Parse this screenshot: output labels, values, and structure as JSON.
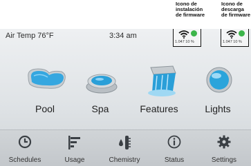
{
  "callouts": [
    {
      "lines": [
        "Icono de",
        "instalación",
        "de firmware"
      ]
    },
    {
      "lines": [
        "Icono de",
        "descarga",
        "de firmware"
      ]
    }
  ],
  "status_bar": {
    "air_temp": "Air Temp 76°F",
    "time": "3:34 am",
    "indicators": [
      {
        "text": "1.047  10 %",
        "dot_color": "#3cb54a"
      },
      {
        "text": "1.047  10 %",
        "dot_color": "#3cb54a"
      }
    ]
  },
  "main_tiles": [
    {
      "label": "Pool",
      "icon": "pool-icon"
    },
    {
      "label": "Spa",
      "icon": "spa-icon"
    },
    {
      "label": "Features",
      "icon": "waterfall-icon"
    },
    {
      "label": "Lights",
      "icon": "light-bulb-icon"
    }
  ],
  "bottom_nav": [
    {
      "label": "Schedules",
      "icon": "clock-icon"
    },
    {
      "label": "Usage",
      "icon": "bar-chart-icon"
    },
    {
      "label": "Chemistry",
      "icon": "thermometer-drop-icon"
    },
    {
      "label": "Status",
      "icon": "info-icon"
    },
    {
      "label": "Settings",
      "icon": "gear-icon"
    }
  ],
  "colors": {
    "accent_blue": "#2a9fd8",
    "status_green": "#3cb54a",
    "icon_dark": "#3a3f44"
  }
}
